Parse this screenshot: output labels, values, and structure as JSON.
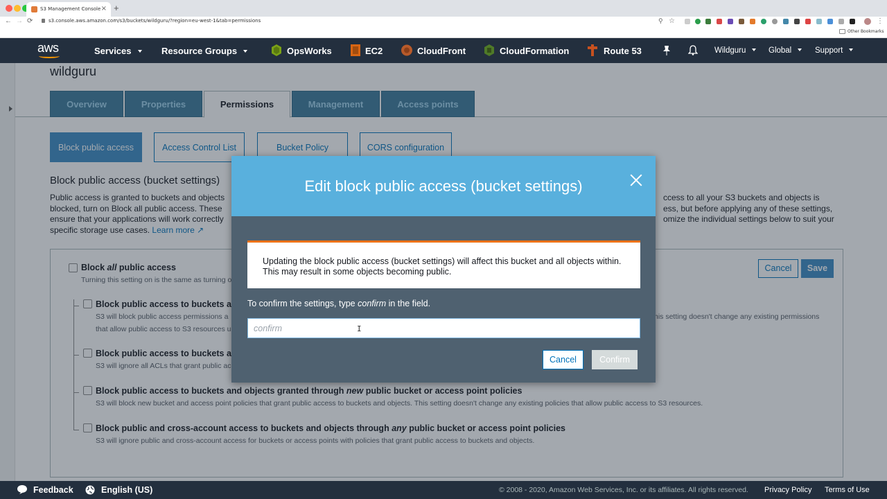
{
  "browser": {
    "tab_title": "S3 Management Console",
    "url": "s3.console.aws.amazon.com/s3/buckets/wildguru/?region=eu-west-1&tab=permissions",
    "bookmarks_label": "Other Bookmarks",
    "new_tab_glyph": "+",
    "close_glyph": "×",
    "back_glyph": "←",
    "forward_glyph": "→",
    "reload_glyph": "⟳",
    "zoom_glyph": "⚲",
    "star_glyph": "☆"
  },
  "aws_nav": {
    "logo": "aws",
    "items": [
      {
        "label": "Services",
        "dropdown": true
      },
      {
        "label": "Resource Groups",
        "dropdown": true
      },
      {
        "label": "OpsWorks"
      },
      {
        "label": "EC2"
      },
      {
        "label": "CloudFront"
      },
      {
        "label": "CloudFormation"
      },
      {
        "label": "Route 53"
      }
    ],
    "pin_glyph": "📌",
    "bell_glyph": "🔔",
    "account": "Wildguru",
    "region": "Global",
    "support": "Support"
  },
  "page": {
    "bucket_name": "wildguru",
    "tabs": [
      "Overview",
      "Properties",
      "Permissions",
      "Management",
      "Access points"
    ],
    "active_tab": "Permissions",
    "subtabs": [
      "Block public access",
      "Access Control List",
      "Bucket Policy",
      "CORS configuration"
    ],
    "active_subtab": "Block public access",
    "section_title": "Block public access (bucket settings)",
    "section_desc_left_1": "Public access is granted to buckets and objects",
    "section_desc_left_2": "blocked, turn on Block all public access. These",
    "section_desc_left_3": "ensure that your applications will work correctly",
    "section_desc_left_4": "specific storage use cases.",
    "learn_more": "Learn more",
    "section_desc_right_1": "ccess to all your S3 buckets and objects is",
    "section_desc_right_2": "ess, but before applying any of these settings,",
    "section_desc_right_3": "omize the individual settings below to suit your",
    "block_all_prefix": "Block",
    "block_all_em": "all",
    "block_all_suffix": "public access",
    "block_all_desc": "Turning this setting on is the same as turning o",
    "cancel": "Cancel",
    "save": "Save",
    "setting_1_title": "Block public access to buckets ar",
    "setting_1_desc_a": "S3 will block public access permissions a",
    "setting_1_desc_b": "that allow public access to S3 resources u",
    "setting_1_desc_right": "his setting doesn't change any existing permissions",
    "setting_2_title": "Block public access to buckets ar",
    "setting_2_desc": "S3 will ignore all ACLs that grant public ac",
    "setting_3_title_a": "Block public access to buckets and objects granted through",
    "setting_3_title_em": "new",
    "setting_3_title_b": "public bucket or access point policies",
    "setting_3_desc": "S3 will block new bucket and access point policies that grant public access to buckets and objects. This setting doesn't change any existing policies that allow public access to S3 resources.",
    "setting_4_title_a": "Block public and cross-account access to buckets and objects through",
    "setting_4_title_em": "any",
    "setting_4_title_b": "public bucket or access point policies",
    "setting_4_desc": "S3 will ignore public and cross-account access for buckets or access points with policies that grant public access to buckets and objects."
  },
  "modal": {
    "title": "Edit block public access (bucket settings)",
    "warning_line_1": "Updating the block public access (bucket settings) will affect this bucket and all objects within.",
    "warning_line_2": "This may result in some objects becoming public.",
    "prompt_prefix": "To confirm the settings, type",
    "prompt_em": "confirm",
    "prompt_suffix": "in the field.",
    "input_placeholder": "confirm",
    "input_value": "",
    "cancel": "Cancel",
    "confirm": "Confirm",
    "cursor_glyph": "I"
  },
  "footer": {
    "feedback": "Feedback",
    "language": "English (US)",
    "copyright": "© 2008 - 2020, Amazon Web Services, Inc. or its affiliates. All rights reserved.",
    "privacy": "Privacy Policy",
    "terms": "Terms of Use"
  },
  "colors": {
    "aws_nav": "#232f3e",
    "modal_header": "#59b0dd",
    "modal_body": "#4f6170",
    "warning_accent": "#ec7211",
    "link": "#0073bb",
    "tab_bg": "#3d7b9c"
  }
}
